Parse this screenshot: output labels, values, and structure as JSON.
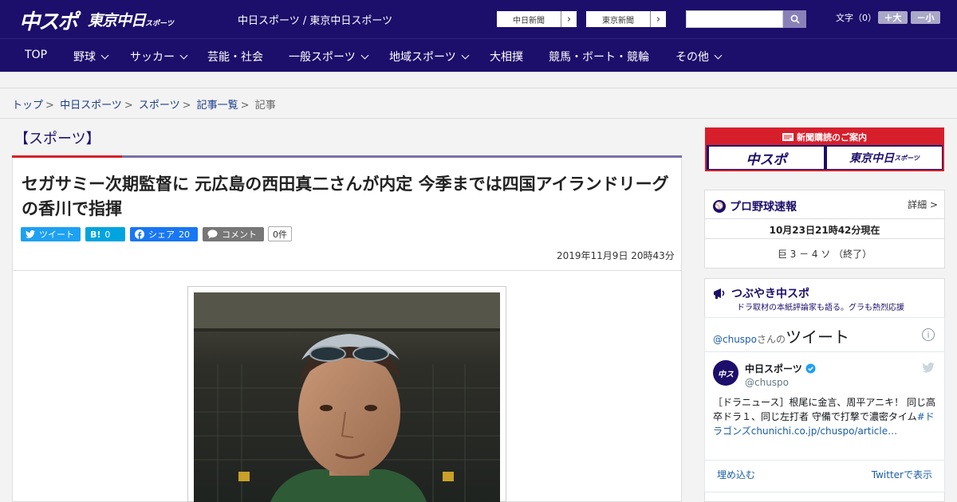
{
  "header": {
    "logo_main": "中スポ",
    "logo_tokyo": "東京中日",
    "logo_tokyo_sub": "スポーツ",
    "site_links": "中日スポーツ / 東京中日スポーツ",
    "ext_link_1": "中日新聞",
    "ext_link_2": "東京新聞",
    "search_placeholder": "",
    "font_size_label": "文字（0）",
    "font_increase": "＋大",
    "font_decrease": "－小"
  },
  "nav": {
    "items": [
      {
        "label": "TOP"
      },
      {
        "label": "野球"
      },
      {
        "label": "サッカー"
      },
      {
        "label": "芸能・社会"
      },
      {
        "label": "一般スポーツ"
      },
      {
        "label": "地域スポーツ"
      },
      {
        "label": "大相撲"
      },
      {
        "label": "競馬・ボート・競輪"
      },
      {
        "label": "その他"
      }
    ]
  },
  "breadcrumb": {
    "items": [
      "トップ",
      "中日スポーツ",
      "スポーツ",
      "記事一覧"
    ],
    "current": "記事"
  },
  "article": {
    "category": "【スポーツ】",
    "headline": "セガサミー次期監督に 元広島の西田真二さんが内定 今季までは四国アイランドリーグの香川で指揮",
    "share": {
      "tweet": "ツイート",
      "hatena": "B!",
      "hatena_count": "0",
      "facebook": "シェア",
      "facebook_count": "20",
      "comment": "コメント",
      "comment_count": "0件"
    },
    "date": "2019年11月9日 20時43分"
  },
  "sidebar": {
    "subscribe": {
      "caption": "新聞購読のご案内",
      "logo_1": "中スポ",
      "logo_2": "東京中日",
      "logo_2_sub": "スポーツ"
    },
    "baseball": {
      "title": "プロ野球速報",
      "detail": "詳細 >",
      "timestamp": "10月23日21時42分現在",
      "score": "巨 3 － 4 ソ （終了）"
    },
    "tweets": {
      "title": "つぶやき中スポ",
      "subtitle": "ドラ取材の本紙評論家も語る。グラも熱烈応援",
      "handle_prefix": "@chuspo",
      "handle_suffix": "さんの",
      "tweets_label": "ツイート",
      "account_name": "中日スポーツ",
      "account_handle": "@chuspo",
      "tweet_text": "［ドラニュース］根尾に金言、周平アニキ！ 同じ高卒ドラ１、同じ左打者 守備で打撃で濃密タイム",
      "tweet_hashtag": "#ドラゴンズ",
      "tweet_link": "chunichi.co.jp/chuspo/article…",
      "embed": "埋め込む",
      "view_on": "Twitterで表示"
    }
  },
  "colors": {
    "brand_navy": "#1c0e6b",
    "accent_red": "#d71f2c",
    "twitter_blue": "#1da1f2",
    "hatena_blue": "#00a4de",
    "facebook_blue": "#1877f2"
  }
}
